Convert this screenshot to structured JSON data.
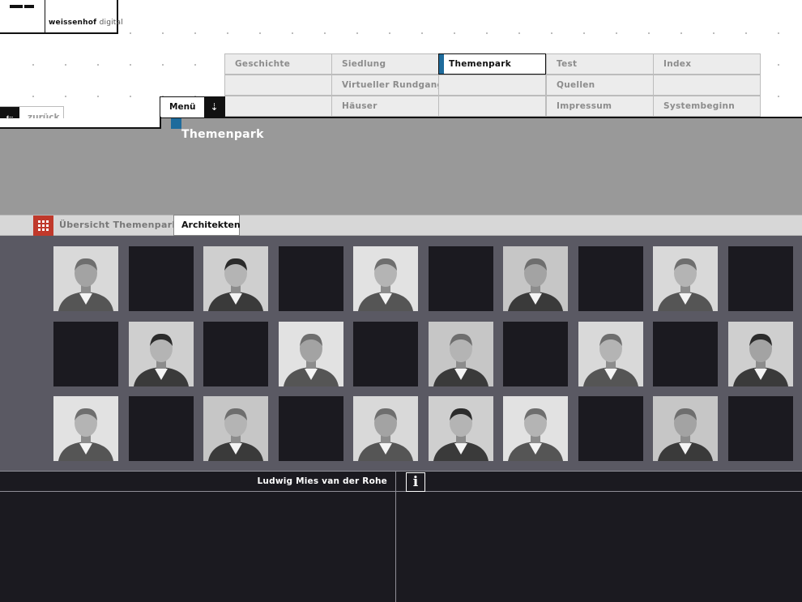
{
  "logo": {
    "brand": "weissenhof",
    "suffix": "digital"
  },
  "menu": {
    "items": [
      [
        "Geschichte",
        "Siedlung",
        "Themenpark",
        "Test",
        "Index"
      ],
      [
        "",
        "Virtueller Rundgang",
        "",
        "Quellen",
        ""
      ],
      [
        "",
        "Häuser",
        "",
        "Impressum",
        "Systembeginn"
      ]
    ],
    "active": "Themenpark"
  },
  "nav": {
    "back_label": "zurück",
    "menu_label": "Menü"
  },
  "header": {
    "title": "Themenpark"
  },
  "subtabs": {
    "overview_label": "Übersicht Themenpark",
    "active_tab": "Architekten"
  },
  "grid": {
    "rows": 3,
    "cols": 10,
    "photos": [
      [
        true,
        false,
        true,
        false,
        true,
        false,
        true,
        false,
        true,
        false
      ],
      [
        false,
        true,
        false,
        true,
        false,
        true,
        false,
        true,
        false,
        true
      ],
      [
        true,
        false,
        true,
        false,
        true,
        true,
        true,
        false,
        true,
        false
      ]
    ]
  },
  "selection": {
    "name": "Ludwig Mies van der Rohe",
    "info_icon": "info-icon"
  },
  "colors": {
    "accent": "#1e6b9c",
    "overview_icon": "#c0392b",
    "grid_bg": "#5a5963",
    "cell_dark": "#1b1a20",
    "header_bg": "#999999"
  }
}
